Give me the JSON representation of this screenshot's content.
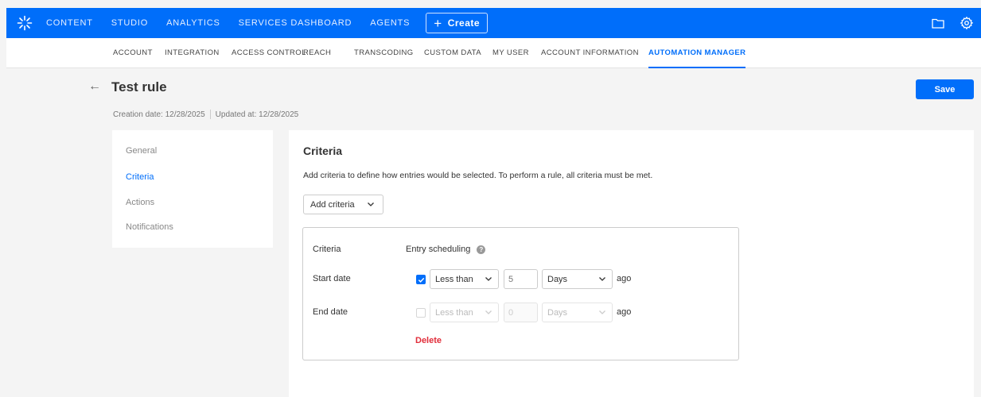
{
  "topbar": {
    "nav": [
      "CONTENT",
      "STUDIO",
      "ANALYTICS",
      "SERVICES DASHBOARD",
      "AGENTS"
    ],
    "create_label": "Create",
    "icons": [
      "folder-icon",
      "gear-icon"
    ]
  },
  "subnav": {
    "items": [
      "ACCOUNT",
      "INTEGRATION",
      "ACCESS CONTROL",
      "REACH",
      "TRANSCODING",
      "CUSTOM DATA",
      "MY USER",
      "ACCOUNT INFORMATION",
      "AUTOMATION MANAGER"
    ],
    "active": "AUTOMATION MANAGER"
  },
  "header": {
    "title": "Test rule",
    "creation": "Creation date: 12/28/2025",
    "updated": "Updated at: 12/28/2025",
    "save_label": "Save"
  },
  "sidemenu": {
    "items": [
      "General",
      "Criteria",
      "Actions",
      "Notifications"
    ],
    "active": "Criteria"
  },
  "criteria": {
    "title": "Criteria",
    "description": "Add criteria to define how entries would be selected. To perform a rule, all criteria must be met.",
    "add_label": "Add criteria",
    "box": {
      "criteria_label": "Criteria",
      "criteria_value": "Entry scheduling",
      "help_glyph": "?",
      "start": {
        "label": "Start date",
        "checked": true,
        "operator": "Less than",
        "amount": "5",
        "unit": "Days",
        "suffix": "ago"
      },
      "end": {
        "label": "End date",
        "checked": false,
        "operator": "Less than",
        "amount": "0",
        "unit": "Days",
        "suffix": "ago"
      },
      "delete_label": "Delete"
    }
  },
  "colors": {
    "brand": "#006efa",
    "danger": "#e12d3a"
  }
}
